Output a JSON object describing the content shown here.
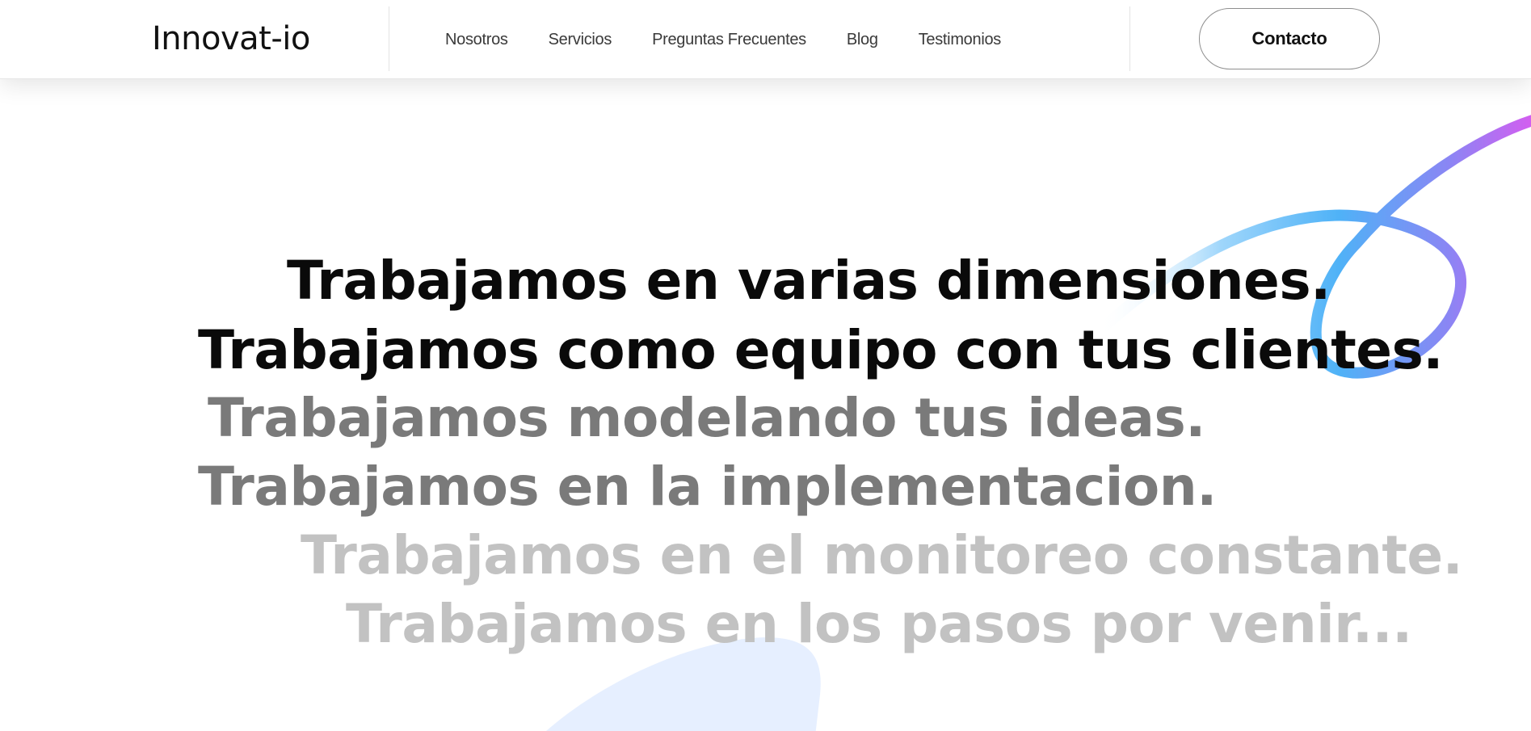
{
  "header": {
    "logo": "Innovat-io",
    "nav": [
      {
        "label": "Nosotros"
      },
      {
        "label": "Servicios"
      },
      {
        "label": "Preguntas Frecuentes"
      },
      {
        "label": "Blog"
      },
      {
        "label": "Testimonios"
      }
    ],
    "contact_label": "Contacto"
  },
  "hero": {
    "lines": [
      {
        "text": "Trabajamos en varias dimensiones.",
        "color": "#0a0a0a"
      },
      {
        "text": "Trabajamos como equipo con tus clientes.",
        "color": "#0a0a0a"
      },
      {
        "text": "Trabajamos modelando tus ideas.",
        "color": "#7a7a7a"
      },
      {
        "text": "Trabajamos en la implementacion.",
        "color": "#7a7a7a"
      },
      {
        "text": "Trabajamos en el monitoreo constante.",
        "color": "#c2c2c2"
      },
      {
        "text": "Trabajamos en los pasos por venir...",
        "color": "#c2c2c2"
      }
    ]
  },
  "colors": {
    "swirl_start": "#d65cf0",
    "swirl_mid": "#4fb2f7",
    "swirl_end": "#e8f6ff",
    "blob": "#e6efff"
  }
}
